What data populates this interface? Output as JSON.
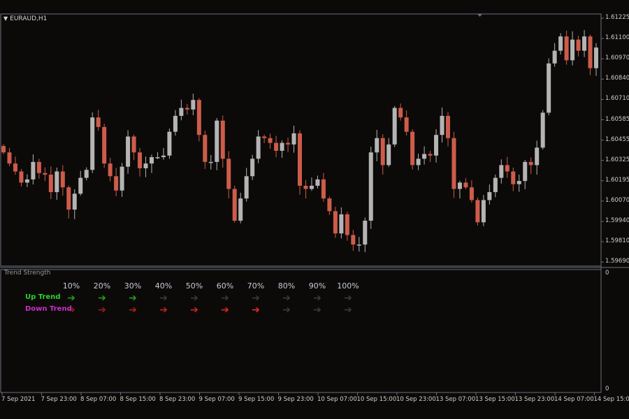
{
  "symbol": {
    "label": "EURAUD,H1",
    "menu_icon": "triangle-down-icon"
  },
  "indicator": {
    "title": "Trend Strength",
    "scale_top": "0",
    "scale_bottom": "0",
    "levels": [
      "10%",
      "20%",
      "30%",
      "40%",
      "50%",
      "60%",
      "70%",
      "80%",
      "90%",
      "100%"
    ],
    "up_label": "Up Trend",
    "down_label": "Down Trend",
    "up_active_count": 3,
    "down_active_count": 7,
    "arrow_glyph": "➔",
    "colors": {
      "up_label": "#2ed02e",
      "down_label": "#c830c8",
      "up_active": "#1f9e1f",
      "inactive": "#3a3a3a",
      "down_shades": [
        "#8c1a1a",
        "#9e1c1c",
        "#b01f1f",
        "#c22222",
        "#d42424",
        "#e52525",
        "#f22828"
      ]
    }
  },
  "price_axis": [
    "1.61225",
    "1.61100",
    "1.60970",
    "1.60840",
    "1.60710",
    "1.60585",
    "1.60455",
    "1.60325",
    "1.60195",
    "1.60070",
    "1.59940",
    "1.59810",
    "1.59690"
  ],
  "time_axis": [
    "7 Sep 2021",
    "7 Sep 23:00",
    "8 Sep 07:00",
    "8 Sep 15:00",
    "8 Sep 23:00",
    "9 Sep 07:00",
    "9 Sep 15:00",
    "9 Sep 23:00",
    "10 Sep 07:00",
    "10 Sep 15:00",
    "10 Sep 23:00",
    "13 Sep 07:00",
    "13 Sep 15:00",
    "13 Sep 23:00",
    "14 Sep 07:00",
    "14 Sep 15:00"
  ],
  "colors": {
    "bull": "#b4b4b4",
    "bear": "#cd5c4a",
    "background": "#0c0a09",
    "frame": "#6a7080"
  },
  "chart_data": {
    "type": "candlestick",
    "symbol": "EURAUD",
    "timeframe": "H1",
    "ylim": [
      1.5969,
      1.61225
    ],
    "closes": [
      1.6038,
      1.6031,
      1.6026,
      1.6019,
      1.6021,
      1.6032,
      1.6025,
      1.6024,
      1.6013,
      1.6026,
      1.6016,
      1.6002,
      1.6012,
      1.6022,
      1.6027,
      1.606,
      1.6054,
      1.6031,
      1.6023,
      1.6014,
      1.6029,
      1.6048,
      1.6038,
      1.6028,
      1.6031,
      1.6035,
      1.6035,
      1.6036,
      1.6051,
      1.6061,
      1.6066,
      1.6065,
      1.6071,
      1.6049,
      1.6032,
      1.6032,
      1.6058,
      1.6034,
      1.6015,
      1.5995,
      1.6009,
      1.6023,
      1.6034,
      1.6048,
      1.6047,
      1.6044,
      1.6039,
      1.6044,
      1.6043,
      1.605,
      1.6017,
      1.6015,
      1.6017,
      1.6021,
      1.6009,
      1.6001,
      1.5987,
      1.5999,
      1.5986,
      1.598,
      1.598,
      1.5995,
      1.6038,
      1.6047,
      1.603,
      1.6043,
      1.6066,
      1.606,
      1.6051,
      1.603,
      1.6034,
      1.6037,
      1.6036,
      1.6049,
      1.6061,
      1.6047,
      1.6015,
      1.6019,
      1.6016,
      1.6008,
      1.5994,
      1.6008,
      1.6013,
      1.6022,
      1.603,
      1.6026,
      1.6018,
      1.602,
      1.6032,
      1.603,
      1.6041,
      1.6063,
      1.6094,
      1.6102,
      1.6111,
      1.6096,
      1.6109,
      1.6102,
      1.6111,
      1.6091,
      1.6104
    ]
  }
}
